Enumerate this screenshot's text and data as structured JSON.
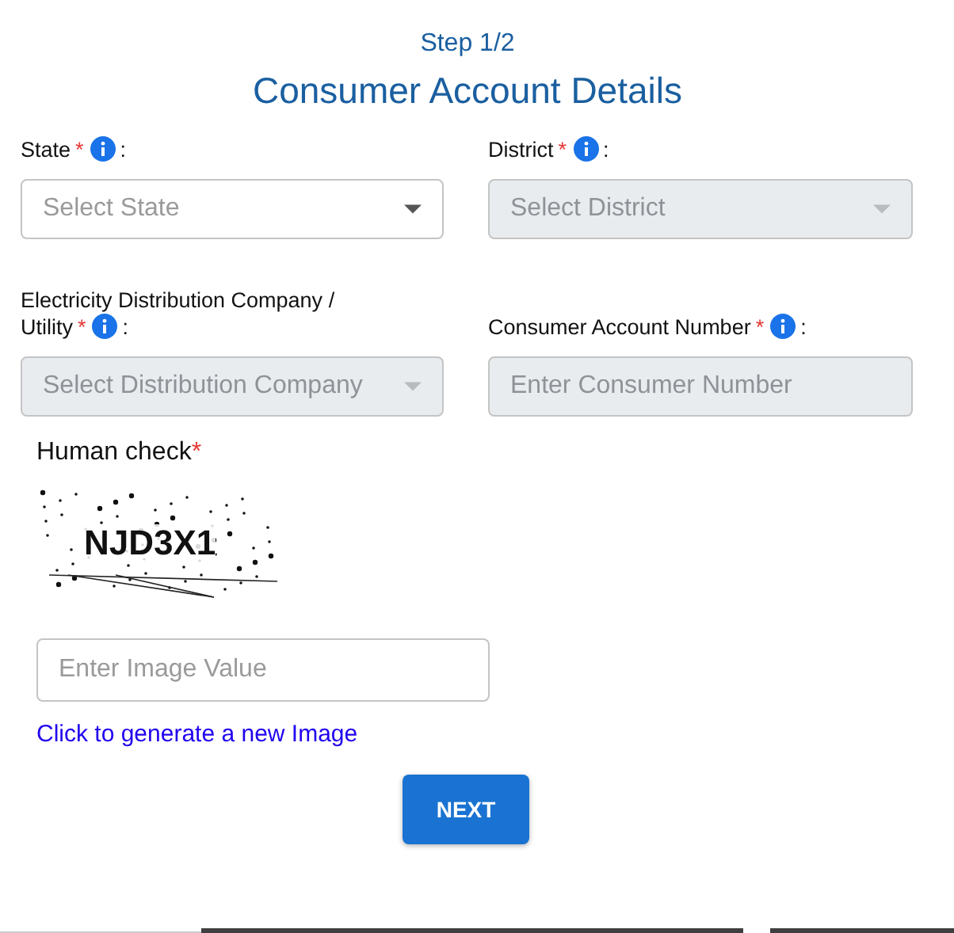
{
  "step": "Step 1/2",
  "title": "Consumer Account Details",
  "fields": [
    {
      "kind": "select",
      "label_lines": [
        "State"
      ],
      "asterisk": "*",
      "colon": ":",
      "placeholder": "Select State",
      "disabled": false
    },
    {
      "kind": "select",
      "label_lines": [
        "District"
      ],
      "asterisk": "*",
      "colon": ":",
      "placeholder": "Select District",
      "disabled": true
    },
    {
      "kind": "select",
      "label_lines": [
        "Electricity Distribution Company /",
        "Utility"
      ],
      "asterisk": "*",
      "colon": ":",
      "placeholder": "Select Distribution Company",
      "disabled": true
    },
    {
      "kind": "input",
      "label_lines": [
        "Consumer Account Number"
      ],
      "asterisk": "*",
      "colon": ":",
      "placeholder": "Enter Consumer Number",
      "disabled": true
    }
  ],
  "captcha": {
    "label": "Human check",
    "asterisk": "*",
    "code": "NJD3X1",
    "placeholder": "Enter Image Value",
    "link": "Click to generate a new Image"
  },
  "button": "NEXT"
}
